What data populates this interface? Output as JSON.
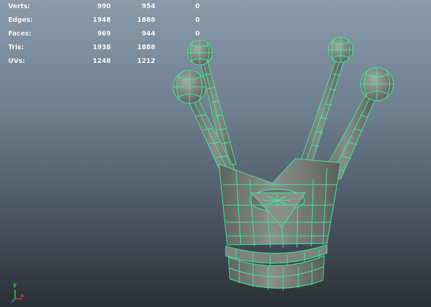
{
  "hud": {
    "rows": [
      {
        "label": "Verts:",
        "v1": "990",
        "v2": "954",
        "v3": "0"
      },
      {
        "label": "Edges:",
        "v1": "1948",
        "v2": "1888",
        "v3": "0"
      },
      {
        "label": "Faces:",
        "v1": "969",
        "v2": "944",
        "v3": "0"
      },
      {
        "label": "Tris:",
        "v1": "1938",
        "v2": "1888",
        "v3": "0"
      },
      {
        "label": "UVs:",
        "v1": "1248",
        "v2": "1212",
        "v3": "0"
      }
    ]
  },
  "axis": {
    "y_label": "y",
    "x_label": "x",
    "y_color": "#3fd24a",
    "x_color": "#e04040"
  },
  "colors": {
    "wireframe": "#3cf09a",
    "mesh_fill": "#7a7f7b",
    "mesh_shadow": "#555a57"
  }
}
